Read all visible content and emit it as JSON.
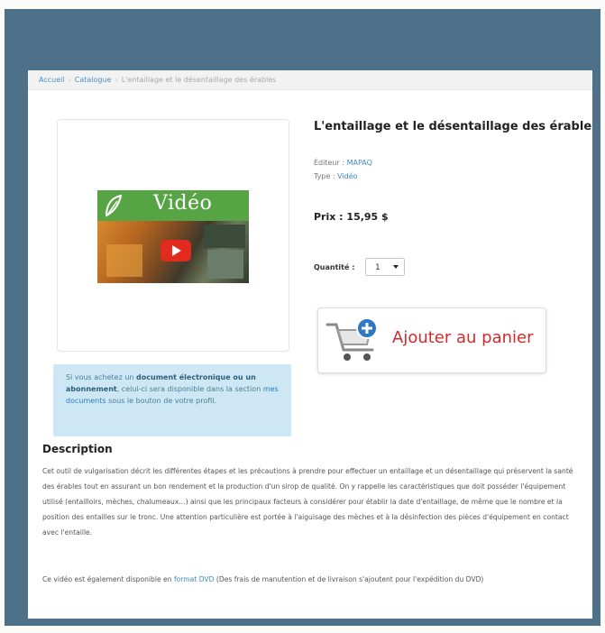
{
  "breadcrumb": {
    "home": "Accueil",
    "catalog": "Catalogue",
    "current": "L'entaillage et le désentaillage des érables"
  },
  "product": {
    "title": "L'entaillage et le désentaillage des érables",
    "publisher_label": "Éditeur : ",
    "publisher": "MAPAQ",
    "type_label": "Type : ",
    "type": "Vidéo",
    "price_label": "Prix : ",
    "price": "15,95 $",
    "quantity_label": "Quantité :",
    "quantity_value": "1",
    "thumbnail_text": "Vidéo"
  },
  "cart": {
    "label": "Ajouter au panier"
  },
  "notice": {
    "p1": "Si vous achetez un ",
    "b1": "document électronique ou un abonnement",
    "p2": ", celui-ci sera disponible dans la section ",
    "link": "mes documents",
    "p3": " sous le bouton de votre profil."
  },
  "description": {
    "title": "Description",
    "body": "Cet outil de vulgarisation décrit les différentes étapes et les précautions à prendre pour effectuer un entaillage et un désentaillage qui préservent la santé des érables tout en assurant un bon rendement et la production d'un sirop de qualité. On y rappelle les caractéristiques que doit posséder l'équipement utilisé (entailloirs, mèches, chalumeaux...) ainsi que les principaux facteurs à considérer pour établir la date d'entaillage, de même que le nombre et la position des entailles sur le tronc. Une attention particulière est portée à l'aiguisage des mèches et à la désinfection des pièces d'équipement en contact avec l'entaille.",
    "note_p1": "Ce vidéo est également disponible en ",
    "note_link": "format DVD",
    "note_p2": " (Des frais de manutention et de livraison s'ajoutent pour l'expédition du DVD)"
  },
  "colors": {
    "frame": "#4f7089",
    "notice_bg": "#cde8f4",
    "link": "#3d8ac4",
    "cart_text": "#d12a2a",
    "thumb_green": "#57a445"
  }
}
